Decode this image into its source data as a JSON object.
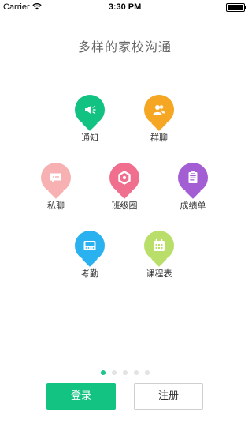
{
  "status_bar": {
    "carrier": "Carrier",
    "time": "3:30 PM"
  },
  "page": {
    "title": "多样的家校沟通"
  },
  "features": [
    {
      "label": "通知",
      "icon": "megaphone-icon",
      "color": "#12c283"
    },
    {
      "label": "群聊",
      "icon": "group-chat-icon",
      "color": "#f5a623"
    },
    {
      "label": "私聊",
      "icon": "private-chat-icon",
      "color": "#f7b1b3"
    },
    {
      "label": "班级圈",
      "icon": "class-circle-icon",
      "color": "#f06f8f"
    },
    {
      "label": "成绩单",
      "icon": "report-card-icon",
      "color": "#a45ed4"
    },
    {
      "label": "考勤",
      "icon": "attendance-icon",
      "color": "#2ab1f0"
    },
    {
      "label": "课程表",
      "icon": "schedule-icon",
      "color": "#b9df6a"
    }
  ],
  "pager": {
    "total": 5,
    "active": 1,
    "active_color": "#1ec38e",
    "inactive_color": "#e3e3e3"
  },
  "actions": {
    "login_label": "登录",
    "register_label": "注册"
  }
}
